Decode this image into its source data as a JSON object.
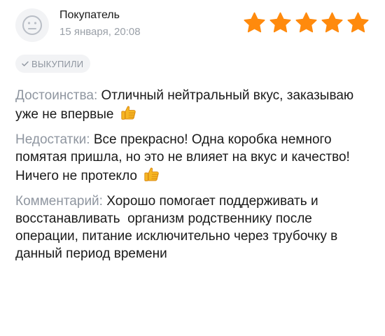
{
  "review": {
    "author": "Покупатель",
    "date": "15 января, 20:08",
    "rating": 5,
    "rating_max": 5,
    "badge_label": "ВЫКУПИЛИ",
    "sections": [
      {
        "label": "Достоинства:",
        "text": "Отличный нейтральный вкус, заказываю уже не впервые",
        "emoji": "thumbs-up-icon"
      },
      {
        "label": "Недостатки:",
        "text": "Все прекрасно! Одна коробка немного помятая пришла, но это не влияет на вкус и качество! Ничего не протекло",
        "emoji": "thumbs-up-icon"
      },
      {
        "label": "Комментарий:",
        "text": "Хорошо помогает поддерживать и восстанавливать  организм родственнику после операции, питание исключительно через трубочку в данный период времени"
      }
    ]
  },
  "colors": {
    "star": "#ff8a0d",
    "label": "#8f96a0",
    "badge_bg": "#f2f3f5",
    "text": "#1a1a1a"
  },
  "icons": {
    "avatar": "neutral-face-icon",
    "badge": "check-icon",
    "rating": "star-icon"
  }
}
